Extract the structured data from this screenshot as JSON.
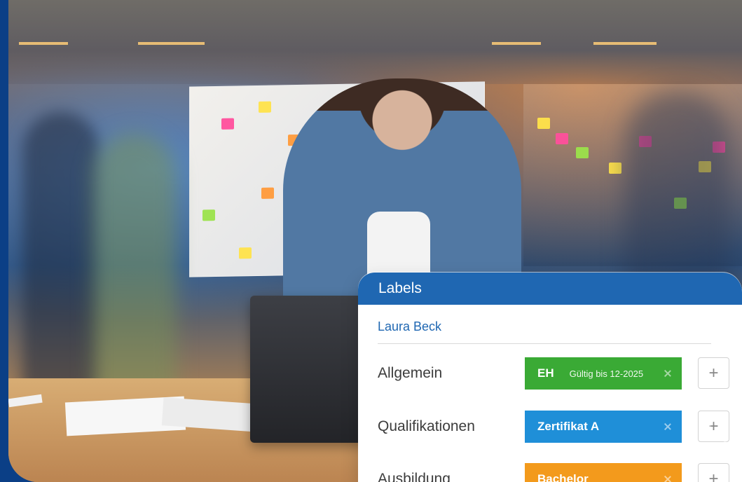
{
  "panel": {
    "title": "Labels",
    "person_name": "Laura Beck",
    "rows": [
      {
        "label": "Allgemein",
        "tag_label": "EH",
        "tag_detail": "Gültig bis 12-2025",
        "tag_color": "#3aaa35"
      },
      {
        "label": "Qualifikationen",
        "tag_label": "Zertifikat A",
        "tag_detail": "",
        "tag_color": "#1f8fd8"
      },
      {
        "label": "Ausbildung",
        "tag_label": "Bachelor",
        "tag_detail": "",
        "tag_color": "#f39a1c"
      }
    ],
    "add_button_symbol": "+"
  },
  "colors": {
    "frame_blue": "#0b3f86",
    "header_blue": "#1f67b2",
    "green": "#3aaa35",
    "blue": "#1f8fd8",
    "orange": "#f39a1c"
  },
  "icons": {
    "remove": "close-icon",
    "add": "plus-icon"
  }
}
